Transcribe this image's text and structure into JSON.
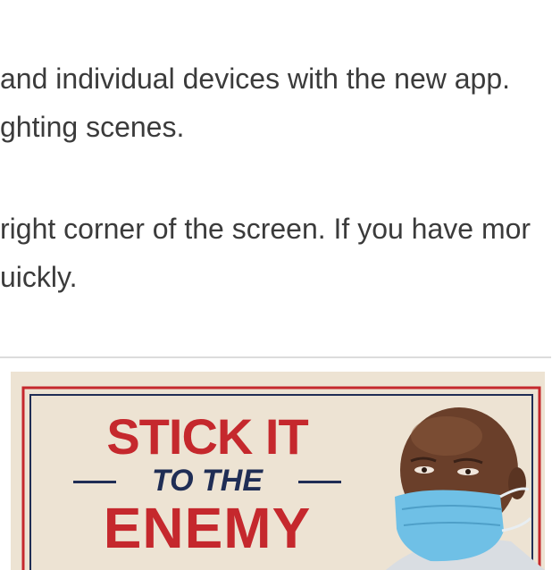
{
  "article": {
    "lines": [
      " and individual devices with the new app.",
      "ghting scenes.",
      "right corner of the screen. If you have mor",
      "uickly."
    ]
  },
  "ad": {
    "line1": "STICK IT",
    "line2": "TO THE",
    "line3": "ENEMY"
  },
  "colors": {
    "poster_red": "#c5282d",
    "poster_navy": "#1f2d55",
    "poster_bg": "#ede3d3",
    "mask_blue": "#6fc0e6"
  }
}
